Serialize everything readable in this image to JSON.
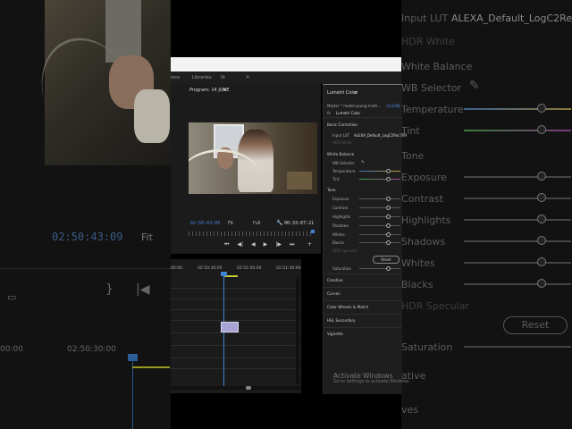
{
  "background_left": {
    "timecode": "02:50:43:09",
    "fit": "Fit",
    "ruler_a": "00:00",
    "ruler_b": "02:50:30:00"
  },
  "background_right": {
    "input_lut_label": "Input LUT",
    "input_lut_value": "ALEXA_Default_LogC2Rec709",
    "hdr_white": "HDR White",
    "white_balance": "White Balance",
    "wb_selector": "WB Selector",
    "temperature": "Temperature",
    "tint": "Tint",
    "tone": "Tone",
    "exposure": "Exposure",
    "contrast": "Contrast",
    "highlights": "Highlights",
    "shadows": "Shadows",
    "whites": "Whites",
    "blacks": "Blacks",
    "hdr_specular": "HDR Specular",
    "reset": "Reset",
    "saturation": "Saturation",
    "creative": "ative",
    "curves": "ves"
  },
  "tabs": {
    "a": "ions",
    "b": "Libraries",
    "c": "lIt",
    "more": "»"
  },
  "program_monitor": {
    "title": "Program: 14 JUNE",
    "menu": "≡",
    "timecode": "02:50:43:09",
    "zoom": "Fit",
    "resolution": "Full",
    "duration": "00:33:07:21",
    "controls": [
      "⏮",
      "◀|",
      "◀",
      "▶",
      "▶",
      "|▶",
      "⏭"
    ]
  },
  "timeline": {
    "ruler": [
      "00:00",
      "02:50:30:00",
      "02:51:00:00",
      "02:51:30:00"
    ]
  },
  "lumetri": {
    "title": "Lumetri Color",
    "menu": "≡",
    "master_clip": "Master * model-young-moth...",
    "sequence": "14 JUNE",
    "fx": "fx",
    "effect_name": "Lumetri Color",
    "basic_correction": "Basic Correction",
    "input_lut_label": "Input LUT",
    "input_lut_value": "ALEXA_Default_LogC2Rec709",
    "hdr_white": "HDR White",
    "white_balance": "White Balance",
    "wb_selector": "WB Selector",
    "temperature": "Temperature",
    "tint": "Tint",
    "tone": "Tone",
    "exposure": "Exposure",
    "contrast": "Contrast",
    "highlights": "Highlights",
    "shadows": "Shadows",
    "whites": "Whites",
    "blacks": "Blacks",
    "hdr_specular": "HDR Specular",
    "reset": "Reset",
    "saturation": "Saturation",
    "creative": "Creative",
    "curves": "Curves",
    "color_wheels": "Color Wheels & Match",
    "hsl_secondary": "HSL Secondary",
    "vignette": "Vignette",
    "activate_title": "Activate Windows",
    "activate_sub": "Go to Settings to activate Windows."
  }
}
